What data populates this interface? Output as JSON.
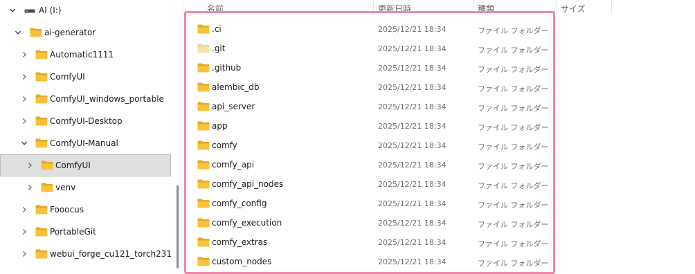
{
  "nav": {
    "items": [
      {
        "label": "AI (I:)",
        "chevron": "down",
        "icon": "drive",
        "indent": 0
      },
      {
        "label": "ai-generator",
        "chevron": "down",
        "icon": "folder",
        "indent": 1
      },
      {
        "label": "Automatic1111",
        "chevron": "right",
        "icon": "folder",
        "indent": 2
      },
      {
        "label": "ComfyUI",
        "chevron": "right",
        "icon": "folder",
        "indent": 2
      },
      {
        "label": "ComfyUI_windows_portable",
        "chevron": "right",
        "icon": "folder",
        "indent": 2
      },
      {
        "label": "ComfyUI-Desktop",
        "chevron": "right",
        "icon": "folder",
        "indent": 2
      },
      {
        "label": "ComfyUI-Manual",
        "chevron": "down",
        "icon": "folder",
        "indent": 2
      },
      {
        "label": "ComfyUI",
        "chevron": "right",
        "icon": "folder",
        "indent": 3,
        "selected": true
      },
      {
        "label": "venv",
        "chevron": "right",
        "icon": "folder",
        "indent": 3
      },
      {
        "label": "Fooocus",
        "chevron": "right",
        "icon": "folder",
        "indent": 2
      },
      {
        "label": "PortableGit",
        "chevron": "right",
        "icon": "folder",
        "indent": 2
      },
      {
        "label": "webui_forge_cu121_torch231",
        "chevron": "right",
        "icon": "folder",
        "indent": 2
      }
    ]
  },
  "columns": {
    "name": "名前",
    "date": "更新日時",
    "type": "種類",
    "size": "サイズ"
  },
  "files": [
    {
      "name": ".ci",
      "date": "2025/12/21 18:34",
      "type": "ファイル フォルダー",
      "hidden": false
    },
    {
      "name": ".git",
      "date": "2025/12/21 18:34",
      "type": "ファイル フォルダー",
      "hidden": true
    },
    {
      "name": ".github",
      "date": "2025/12/21 18:34",
      "type": "ファイル フォルダー",
      "hidden": false
    },
    {
      "name": "alembic_db",
      "date": "2025/12/21 18:34",
      "type": "ファイル フォルダー",
      "hidden": false
    },
    {
      "name": "api_server",
      "date": "2025/12/21 18:34",
      "type": "ファイル フォルダー",
      "hidden": false
    },
    {
      "name": "app",
      "date": "2025/12/21 18:34",
      "type": "ファイル フォルダー",
      "hidden": false
    },
    {
      "name": "comfy",
      "date": "2025/12/21 18:34",
      "type": "ファイル フォルダー",
      "hidden": false
    },
    {
      "name": "comfy_api",
      "date": "2025/12/21 18:34",
      "type": "ファイル フォルダー",
      "hidden": false
    },
    {
      "name": "comfy_api_nodes",
      "date": "2025/12/21 18:34",
      "type": "ファイル フォルダー",
      "hidden": false
    },
    {
      "name": "comfy_config",
      "date": "2025/12/21 18:34",
      "type": "ファイル フォルダー",
      "hidden": false
    },
    {
      "name": "comfy_execution",
      "date": "2025/12/21 18:34",
      "type": "ファイル フォルダー",
      "hidden": false
    },
    {
      "name": "comfy_extras",
      "date": "2025/12/21 18:34",
      "type": "ファイル フォルダー",
      "hidden": false
    },
    {
      "name": "custom_nodes",
      "date": "2025/12/21 18:34",
      "type": "ファイル フォルダー",
      "hidden": false
    }
  ],
  "colors": {
    "folder": "#f8c33a",
    "folder_dark": "#e4a823",
    "folder_hidden": "#f6e2b0",
    "highlight_border": "#ef88ac",
    "selected_bg": "#e0e0e0"
  }
}
